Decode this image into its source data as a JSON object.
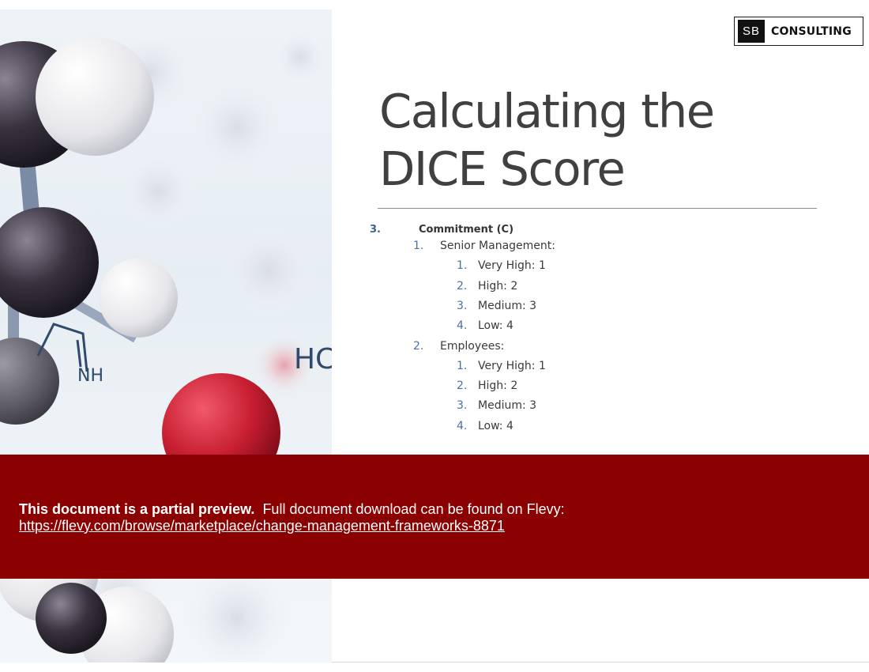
{
  "logo": {
    "mark": "SB",
    "text": "CONSULTING"
  },
  "title": {
    "line1": "Calculating the",
    "line2": "DICE Score"
  },
  "image": {
    "visible_text_1": "HC",
    "visible_text_2": "NH"
  },
  "outline": {
    "section_number": "3.",
    "section_label": "Commitment (C)",
    "groups": [
      {
        "number": "1.",
        "label": "Senior Management:",
        "items": [
          {
            "number": "1.",
            "label": "Very High: 1"
          },
          {
            "number": "2.",
            "label": "High: 2"
          },
          {
            "number": "3.",
            "label": "Medium: 3"
          },
          {
            "number": "4.",
            "label": "Low: 4"
          }
        ]
      },
      {
        "number": "2.",
        "label": "Employees:",
        "items": [
          {
            "number": "1.",
            "label": "Very High: 1"
          },
          {
            "number": "2.",
            "label": "High: 2"
          },
          {
            "number": "3.",
            "label": "Medium: 3"
          },
          {
            "number": "4.",
            "label": "Low: 4"
          }
        ]
      }
    ]
  },
  "banner": {
    "bold_text": "This document is a partial preview.",
    "text": "Full document download can be found on Flevy:",
    "link": "https://flevy.com/browse/marketplace/change-management-frameworks-8871"
  },
  "colors": {
    "banner": "#8b0000",
    "title": "#404040",
    "list_number": "#4a6fa5"
  }
}
